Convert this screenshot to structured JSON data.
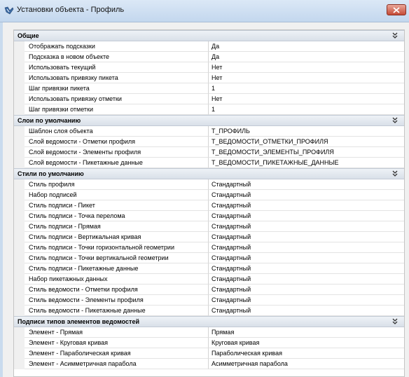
{
  "window": {
    "title": "Установки объекта - Профиль"
  },
  "sections": [
    {
      "title": "Общие",
      "rows": [
        {
          "name": "Отображать подсказки",
          "value": "Да"
        },
        {
          "name": "Подсказка в новом объекте",
          "value": "Да"
        },
        {
          "name": "Использовать текущий",
          "value": "Нет"
        },
        {
          "name": "Использовать привязку пикета",
          "value": "Нет"
        },
        {
          "name": "Шаг привязки пикета",
          "value": "1"
        },
        {
          "name": "Использовать привязку отметки",
          "value": "Нет"
        },
        {
          "name": "Шаг привязки отметки",
          "value": "1"
        }
      ]
    },
    {
      "title": "Слои по умолчанию",
      "rows": [
        {
          "name": "Шаблон слоя объекта",
          "value": "Т_ПРОФИЛЬ"
        },
        {
          "name": "Слой ведомости - Отметки профиля",
          "value": "Т_ВЕДОМОСТИ_ОТМЕТКИ_ПРОФИЛЯ"
        },
        {
          "name": "Слой ведомости - Элементы профиля",
          "value": "Т_ВЕДОМОСТИ_ЭЛЕМЕНТЫ_ПРОФИЛЯ"
        },
        {
          "name": "Слой ведомости - Пикетажные данные",
          "value": "Т_ВЕДОМОСТИ_ПИКЕТАЖНЫЕ_ДАННЫЕ"
        }
      ]
    },
    {
      "title": "Стили по умолчанию",
      "rows": [
        {
          "name": "Стиль профиля",
          "value": "Стандартный"
        },
        {
          "name": "Набор подписей",
          "value": "Стандартный"
        },
        {
          "name": "Стиль подписи - Пикет",
          "value": "Стандартный"
        },
        {
          "name": "Стиль подписи - Точка перелома",
          "value": "Стандартный"
        },
        {
          "name": "Стиль подписи - Прямая",
          "value": "Стандартный"
        },
        {
          "name": "Стиль подписи - Вертикальная кривая",
          "value": "Стандартный"
        },
        {
          "name": "Стиль подписи - Точки горизонтальной геометрии",
          "value": "Стандартный"
        },
        {
          "name": "Стиль подписи - Точки вертикальной геометрии",
          "value": "Стандартный"
        },
        {
          "name": "Стиль подписи - Пикетажные данные",
          "value": "Стандартный"
        },
        {
          "name": "Набор пикетажных данных",
          "value": "Стандартный"
        },
        {
          "name": "Стиль ведомости - Отметки профиля",
          "value": "Стандартный"
        },
        {
          "name": "Стиль ведомости - Элементы профиля",
          "value": "Стандартный"
        },
        {
          "name": "Стиль ведомости - Пикетажные данные",
          "value": "Стандартный"
        }
      ]
    },
    {
      "title": "Подписи типов элементов ведомостей",
      "rows": [
        {
          "name": "Элемент - Прямая",
          "value": "Прямая"
        },
        {
          "name": "Элемент - Круговая кривая",
          "value": "Круговая кривая"
        },
        {
          "name": "Элемент - Параболическая кривая",
          "value": "Параболическая кривая"
        },
        {
          "name": "Элемент - Асимметричная парабола",
          "value": "Асимметричная парабола"
        }
      ]
    }
  ]
}
